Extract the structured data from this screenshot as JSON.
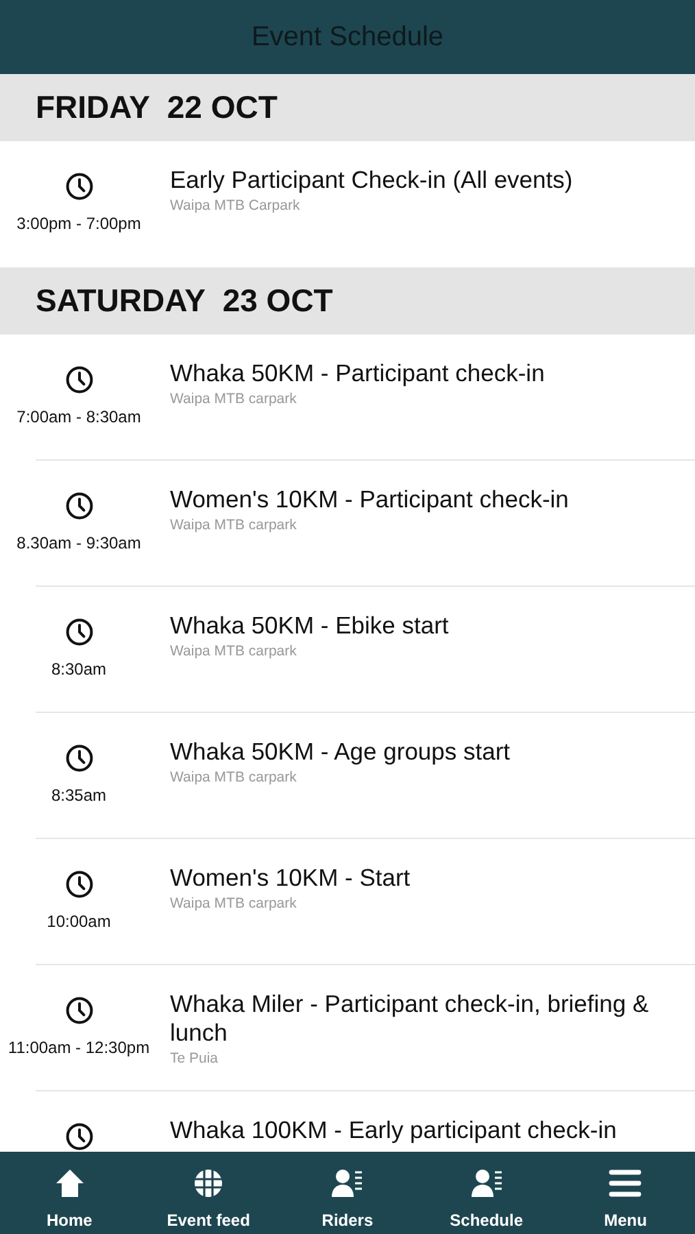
{
  "title": "Event Schedule",
  "days": [
    {
      "heading": "FRIDAY  22 OCT",
      "events": [
        {
          "time": "3:00pm - 7:00pm",
          "title": "Early Participant Check-in (All events)",
          "location": "Waipa MTB Carpark"
        }
      ]
    },
    {
      "heading": "SATURDAY  23 OCT",
      "events": [
        {
          "time": "7:00am - 8:30am",
          "title": "Whaka 50KM - Participant check-in",
          "location": "Waipa MTB carpark"
        },
        {
          "time": "8.30am - 9:30am",
          "title": "Women's 10KM - Participant check-in",
          "location": "Waipa MTB carpark"
        },
        {
          "time": "8:30am",
          "title": "Whaka 50KM - Ebike start",
          "location": "Waipa MTB carpark"
        },
        {
          "time": "8:35am",
          "title": "Whaka 50KM - Age groups start",
          "location": "Waipa MTB carpark"
        },
        {
          "time": "10:00am",
          "title": "Women's 10KM - Start",
          "location": "Waipa MTB carpark"
        },
        {
          "time": "11:00am - 12:30pm",
          "title": "Whaka Miler - Participant check-in, briefing & lunch",
          "location": "Te Puia"
        },
        {
          "title": "Whaka 100KM - Early participant check-in"
        }
      ]
    }
  ],
  "nav": [
    {
      "kind": "home",
      "label": "Home"
    },
    {
      "kind": "globe",
      "label": "Event feed"
    },
    {
      "kind": "person",
      "label": "Riders"
    },
    {
      "kind": "person",
      "label": "Schedule"
    },
    {
      "kind": "menu",
      "label": "Menu"
    }
  ]
}
